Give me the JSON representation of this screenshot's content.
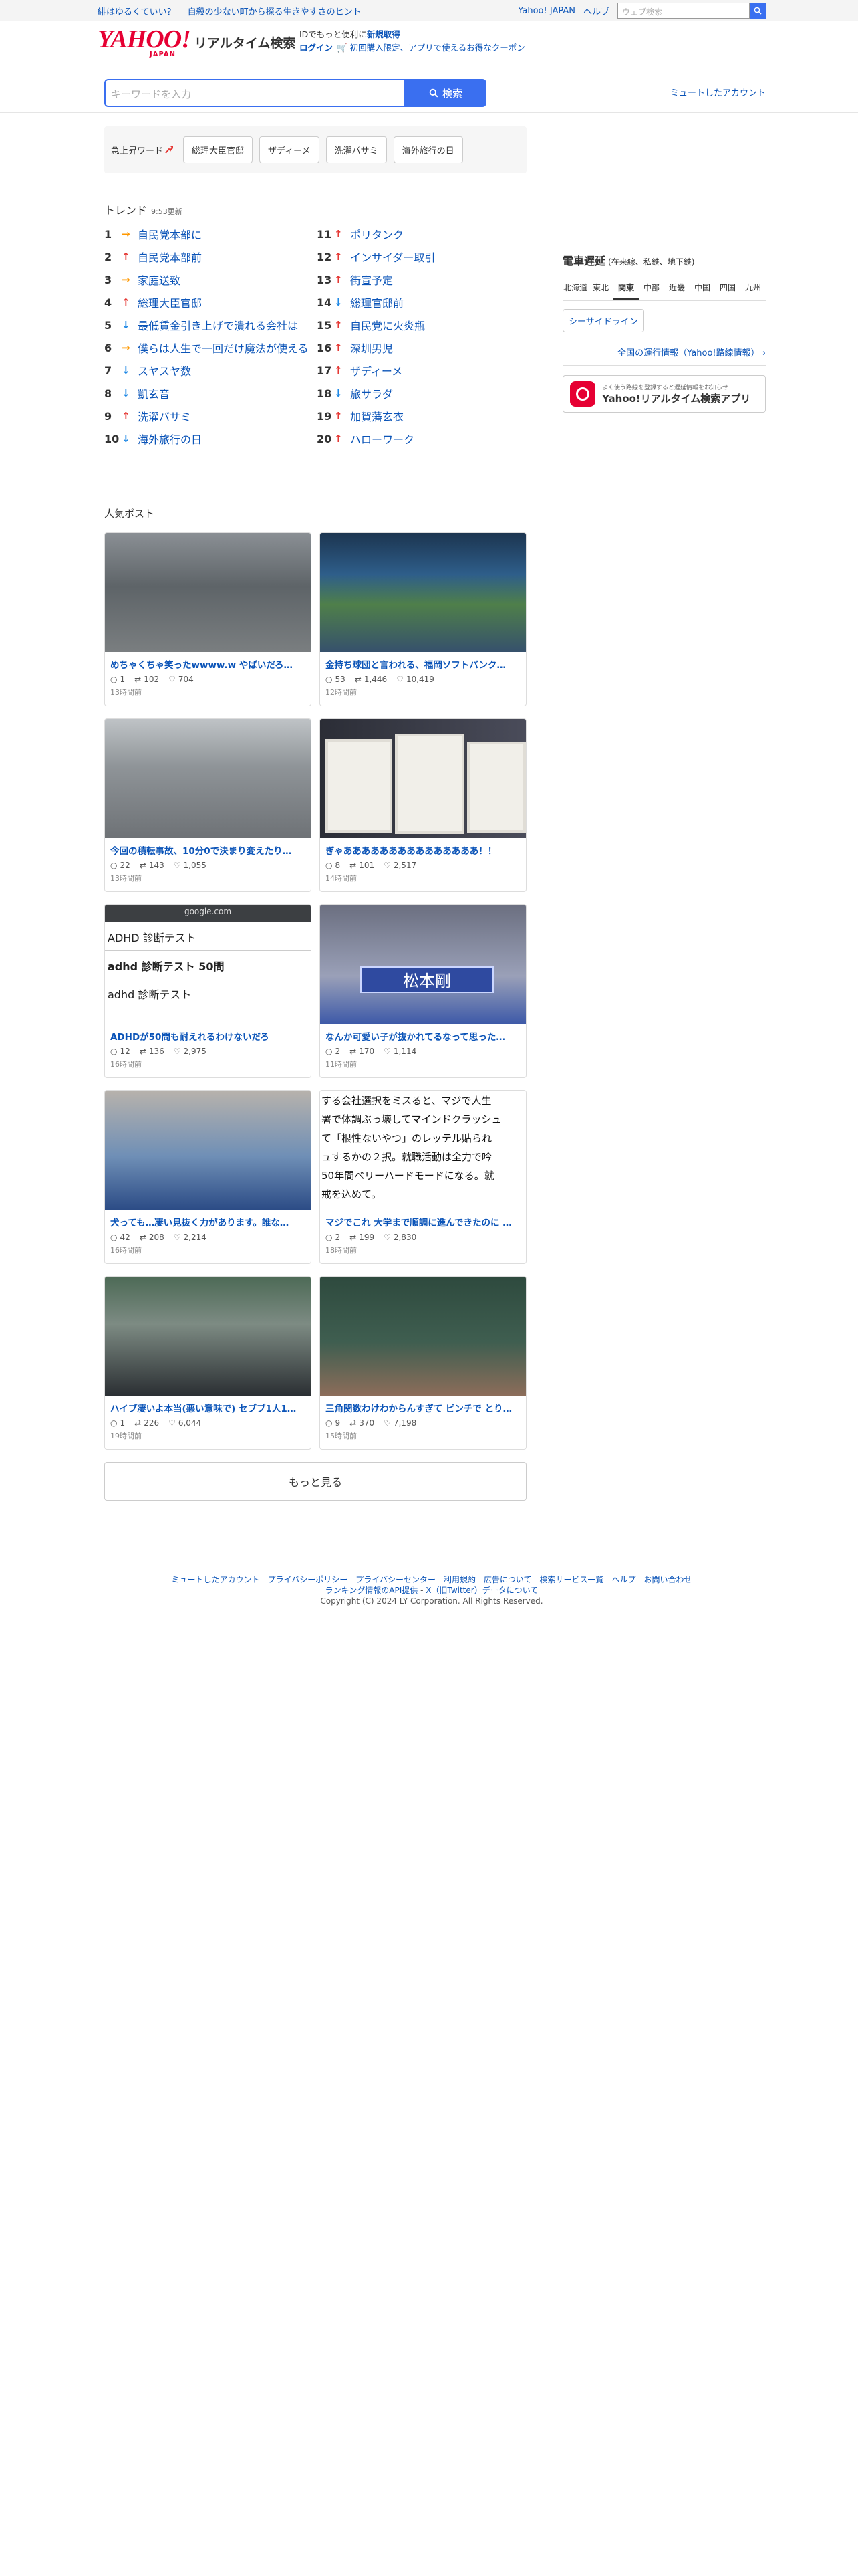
{
  "topbar": {
    "links": [
      "緋はゆるくていい？",
      "自殺の少ない町から探る生きやすさのヒント"
    ],
    "yahoo_japan": "Yahoo! JAPAN",
    "help": "ヘルプ",
    "web_search_placeholder": "ウェブ検索"
  },
  "header": {
    "logo_text": "YAHOO!",
    "logo_sub": "JAPAN",
    "service_name": "リアルタイム検索",
    "promo_line1_a": "IDでもっと便利に",
    "promo_line1_b": "新規取得",
    "login": "ログイン",
    "coupon": "初回購入限定、アプリで使えるお得なクーポン"
  },
  "search": {
    "placeholder": "キーワードを入力",
    "button": "検索",
    "muted_accounts": "ミュートしたアカウント"
  },
  "surge": {
    "label": "急上昇ワード",
    "chips": [
      "総理大臣官邸",
      "ザディーメ",
      "洗濯バサミ",
      "海外旅行の日"
    ]
  },
  "trend": {
    "title": "トレンド",
    "updated": "9:53更新",
    "items": [
      {
        "rank": "1",
        "dir": "flat",
        "word": "自民党本部に"
      },
      {
        "rank": "2",
        "dir": "up",
        "word": "自民党本部前"
      },
      {
        "rank": "3",
        "dir": "flat",
        "word": "家庭送致"
      },
      {
        "rank": "4",
        "dir": "up",
        "word": "総理大臣官邸"
      },
      {
        "rank": "5",
        "dir": "down",
        "word": "最低賃金引き上げで潰れる会社は"
      },
      {
        "rank": "6",
        "dir": "flat",
        "word": "僕らは人生で一回だけ魔法が使える"
      },
      {
        "rank": "7",
        "dir": "down",
        "word": "スヤスヤ数"
      },
      {
        "rank": "8",
        "dir": "down",
        "word": "凱玄音"
      },
      {
        "rank": "9",
        "dir": "up",
        "word": "洗濯バサミ"
      },
      {
        "rank": "10",
        "dir": "down",
        "word": "海外旅行の日"
      },
      {
        "rank": "11",
        "dir": "up",
        "word": "ポリタンク"
      },
      {
        "rank": "12",
        "dir": "up",
        "word": "インサイダー取引"
      },
      {
        "rank": "13",
        "dir": "up",
        "word": "街宣予定"
      },
      {
        "rank": "14",
        "dir": "down",
        "word": "総理官邸前"
      },
      {
        "rank": "15",
        "dir": "up",
        "word": "自民党に火炎瓶"
      },
      {
        "rank": "16",
        "dir": "up",
        "word": "深圳男児"
      },
      {
        "rank": "17",
        "dir": "up",
        "word": "ザディーメ"
      },
      {
        "rank": "18",
        "dir": "down",
        "word": "旅サラダ"
      },
      {
        "rank": "19",
        "dir": "up",
        "word": "加賀藩玄衣"
      },
      {
        "rank": "20",
        "dir": "up",
        "word": "ハローワーク"
      }
    ]
  },
  "train": {
    "title": "電車遅延",
    "sub": "(在来線、私鉄、地下鉄)",
    "regions": [
      "北海道",
      "東北",
      "関東",
      "中部",
      "近畿",
      "中国",
      "四国",
      "九州"
    ],
    "active_region": "関東",
    "line": "シーサイドライン",
    "link": "全国の運行情報（Yahoo!路線情報）"
  },
  "app": {
    "small": "よく使う路線を登録すると遅延情報をお知らせ",
    "name": "Yahoo!リアルタイム検索アプリ"
  },
  "posts_title": "人気ポスト",
  "posts": [
    {
      "title": "めちゃくちゃ笑ったwwww.w やばいだろ…",
      "replies": "1",
      "reposts": "102",
      "likes": "704",
      "time": "13時間前"
    },
    {
      "title": "金持ち球団と言われる、福岡ソフトバンク…",
      "replies": "53",
      "reposts": "1,446",
      "likes": "10,419",
      "time": "12時間前"
    },
    {
      "title": "今回の積転事故、10分0で決まり変えたり…",
      "replies": "22",
      "reposts": "143",
      "likes": "1,055",
      "time": "13時間前"
    },
    {
      "title": "ぎゃあああああああああああああああ！！",
      "replies": "8",
      "reposts": "101",
      "likes": "2,517",
      "time": "14時間前"
    },
    {
      "title": "ADHDが50問も耐えれるわけないだろ",
      "replies": "12",
      "reposts": "136",
      "likes": "2,975",
      "time": "16時間前",
      "thumb_lines": [
        "google.com",
        "ADHD 診断テスト",
        "adhd 診断テスト 50問",
        "adhd 診断テスト"
      ]
    },
    {
      "title": "なんか可愛い子が抜かれてるなって思った…",
      "replies": "2",
      "reposts": "170",
      "likes": "1,114",
      "time": "11時間前",
      "banner": "松本剛"
    },
    {
      "title": "犬っても…凄い見抜く力があります。誰な…",
      "replies": "42",
      "reposts": "208",
      "likes": "2,214",
      "time": "16時間前"
    },
    {
      "title": "マジでこれ 大学まで順調に進んできたのに …",
      "replies": "2",
      "reposts": "199",
      "likes": "2,830",
      "time": "18時間前",
      "thumb_lines": [
        "する会社選択をミスると、マジで人生",
        "署で体調ぶっ壊してマインドクラッシュ",
        "て「根性ないやつ」のレッテル貼られ",
        "ュするかの２択。就職活動は全力で吟",
        "50年間ベリーハードモードになる。就",
        "戒を込めて。"
      ]
    },
    {
      "title": "ハイブ凄いよ本当(悪い意味で) セブブ1人1…",
      "replies": "1",
      "reposts": "226",
      "likes": "6,044",
      "time": "19時間前"
    },
    {
      "title": "三角関数わけわからんすぎて ピンチで とり…",
      "replies": "9",
      "reposts": "370",
      "likes": "7,198",
      "time": "15時間前"
    }
  ],
  "more": "もっと見る",
  "footer": {
    "line1": [
      "ミュートしたアカウント",
      "プライバシーポリシー",
      "プライバシーセンター",
      "利用規約",
      "広告について",
      "検索サービス一覧",
      "ヘルプ",
      "お問い合わせ"
    ],
    "line2": [
      "ランキング情報のAPI提供",
      "X（旧Twitter）データについて"
    ],
    "copyright": "Copyright (C) 2024 LY Corporation. All Rights Reserved."
  },
  "colors": {
    "brand_red": "#e60033",
    "link_blue": "#0b54b8",
    "accent_blue": "#3a6ff0"
  }
}
